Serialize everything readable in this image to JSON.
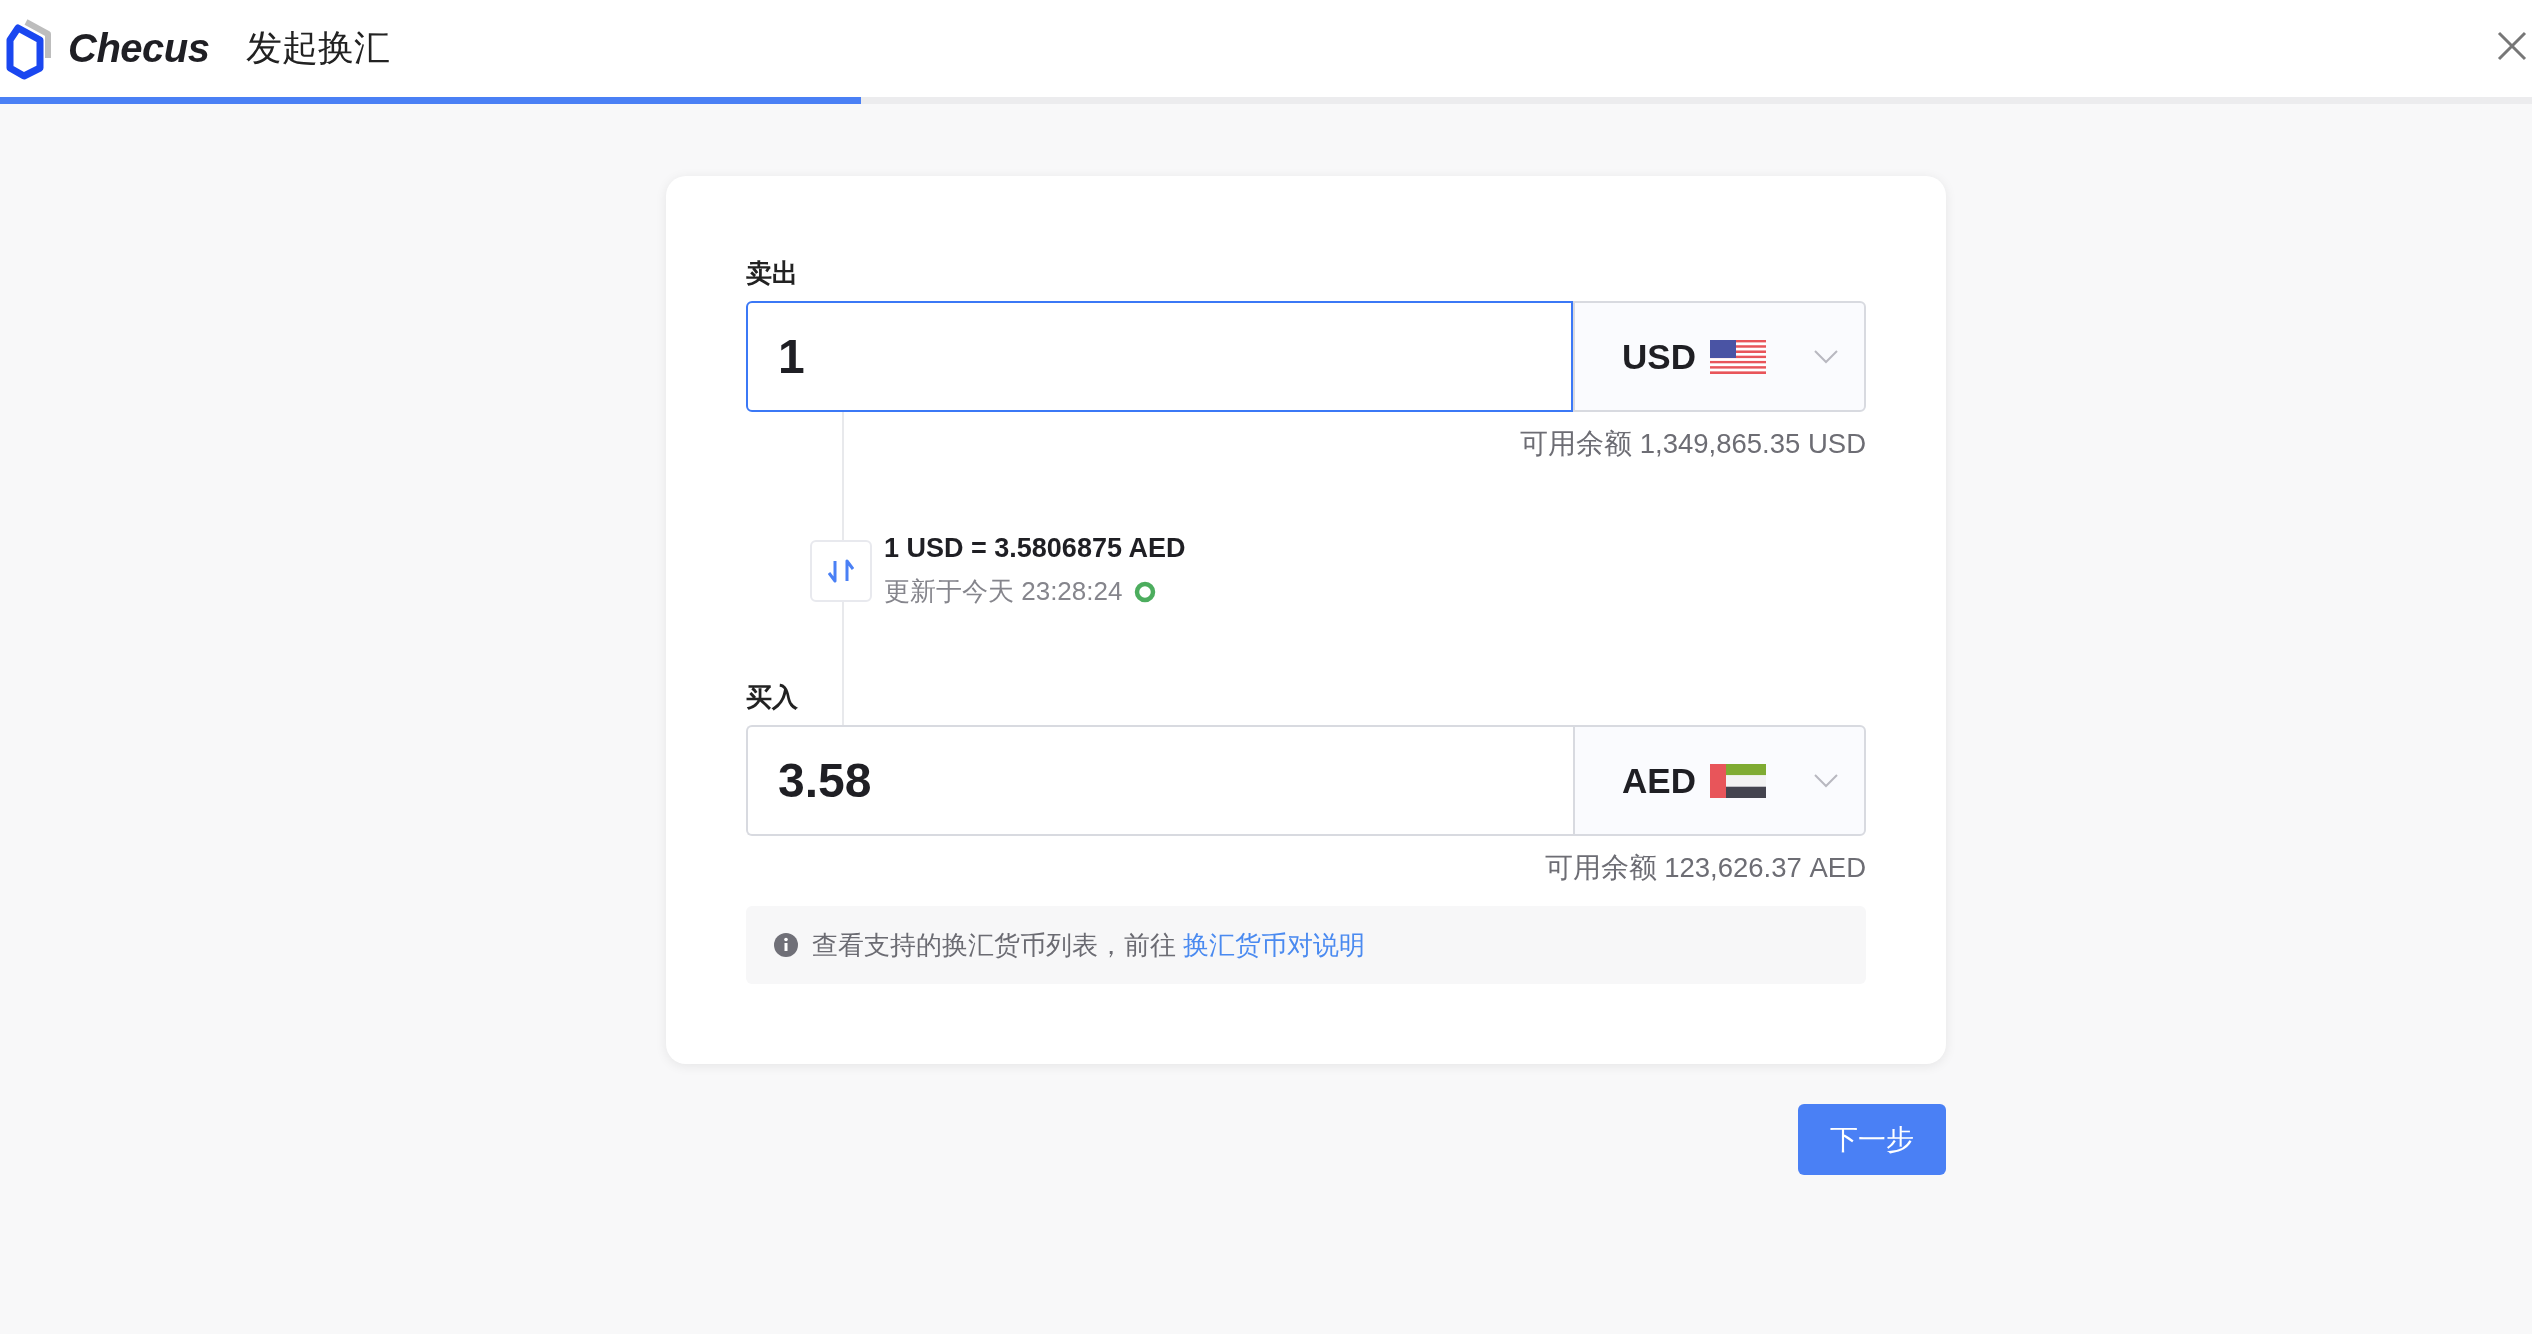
{
  "header": {
    "logo_text": "Checus",
    "title": "发起换汇"
  },
  "progress": {
    "level": 0.34
  },
  "sell": {
    "label": "卖出",
    "value": "1",
    "focused": true,
    "currency": "USD",
    "kind": "us",
    "balance": "可用余额 1,349,865.35 USD"
  },
  "rate": {
    "text": "1 USD = 3.5806875 AED",
    "updated": "更新于今天 23:28:24"
  },
  "buy": {
    "label": "买入",
    "value": "3.58",
    "focused": false,
    "currency": "AED",
    "kind": "ae",
    "balance": "可用余额 123,626.37 AED"
  },
  "notice": {
    "text": "查看支持的换汇货币列表，前往",
    "link": "换汇货币对说明"
  },
  "next_button": "下一步"
}
